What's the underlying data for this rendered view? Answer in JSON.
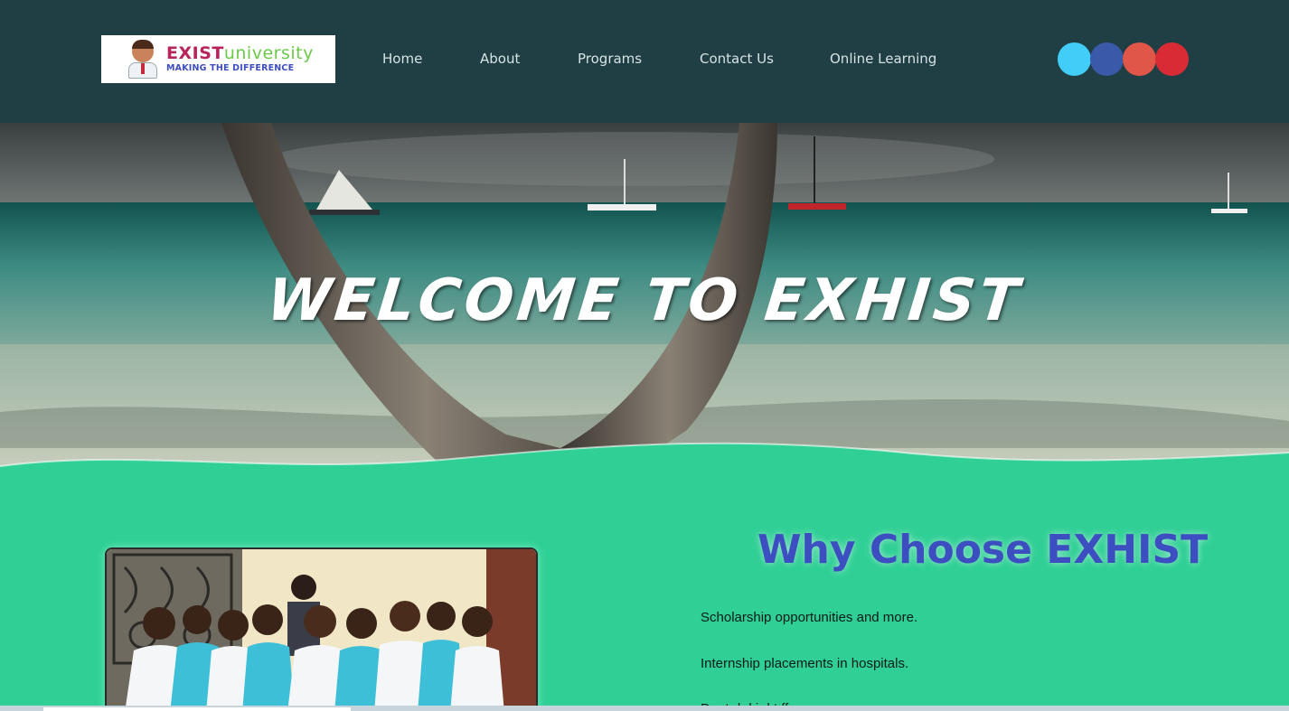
{
  "header": {
    "logo": {
      "title_part1": "EXIST",
      "title_part2": "university",
      "tagline": "MAKING THE DIFFERENCE"
    },
    "nav": [
      {
        "label": "Home"
      },
      {
        "label": "About"
      },
      {
        "label": "Programs"
      },
      {
        "label": "Contact Us"
      },
      {
        "label": "Online Learning"
      }
    ],
    "social": [
      {
        "icon": "circle-light-blue-icon",
        "color": "#41cdf7"
      },
      {
        "icon": "circle-dark-blue-icon",
        "color": "#3a59a8"
      },
      {
        "icon": "circle-coral-icon",
        "color": "#e0574a"
      },
      {
        "icon": "circle-red-icon",
        "color": "#d92b36"
      }
    ]
  },
  "hero": {
    "title": "WELCOME TO EXHIST"
  },
  "why": {
    "title": "Why Choose EXHIST",
    "items": [
      "Scholarship  opportunities and more.",
      "Internship placements in hospitals.",
      "Dout  d  d  i  d  t  ff"
    ]
  },
  "colors": {
    "header_bg": "#1f3f44",
    "accent_green": "#2fcf95",
    "heading_blue": "#3d4fc0"
  }
}
